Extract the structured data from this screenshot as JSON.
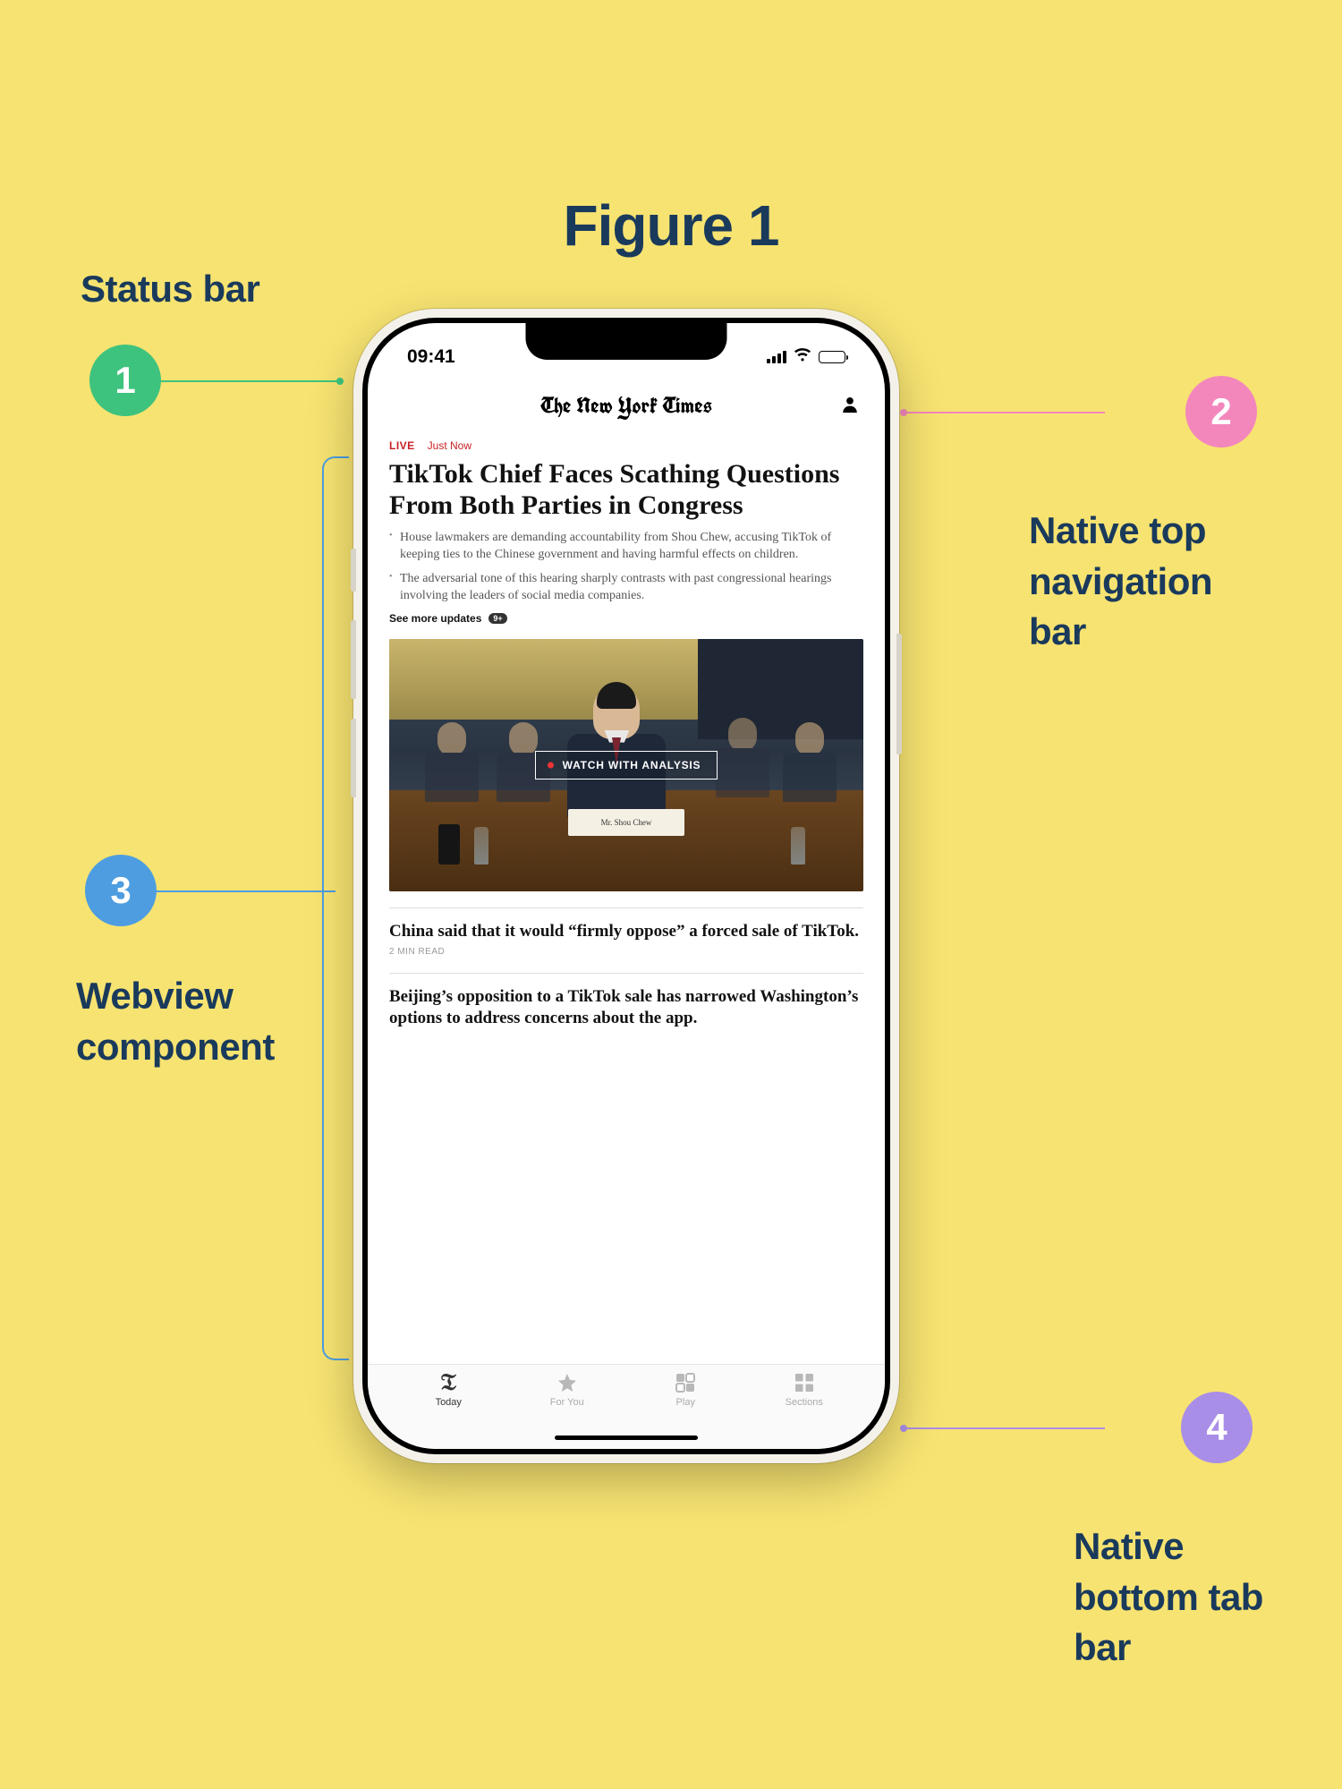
{
  "figure": {
    "title": "Figure 1"
  },
  "annotations": {
    "n1": {
      "num": "1",
      "label": "Status bar",
      "color": "#3ec37e"
    },
    "n2": {
      "num": "2",
      "label": "Native top navigation bar",
      "color": "#f387bc"
    },
    "n3": {
      "num": "3",
      "label": "Webview component",
      "color": "#4d9de0"
    },
    "n4": {
      "num": "4",
      "label": "Native bottom tab bar",
      "color": "#a98ee8"
    }
  },
  "phone": {
    "status_bar": {
      "time": "09:41"
    },
    "top_nav": {
      "title": "The New York Times"
    },
    "content": {
      "live": {
        "badge": "LIVE",
        "time": "Just Now"
      },
      "headline": "TikTok Chief Faces Scathing Questions From Both Parties in Congress",
      "bullets": [
        "House lawmakers are demanding accountability from Shou Chew, accusing TikTok of keeping ties to the Chinese government and having harmful effects on children.",
        "The adversarial tone of this hearing sharply contrasts with past congressional hearings involving the leaders of social media companies."
      ],
      "see_more": {
        "label": "See more updates",
        "count": "9+"
      },
      "video": {
        "button_label": "WATCH WITH ANALYSIS",
        "nameplate": "Mr. Shou Chew"
      },
      "story2": {
        "headline": "China said that it would “firmly oppose” a forced sale of TikTok.",
        "read_time": "2 MIN READ"
      },
      "story3": {
        "headline": "Beijing’s opposition to a TikTok sale has narrowed Washington’s options to address concerns about the app."
      }
    },
    "tabs": [
      {
        "label": "Today",
        "active": true
      },
      {
        "label": "For You",
        "active": false
      },
      {
        "label": "Play",
        "active": false
      },
      {
        "label": "Sections",
        "active": false
      }
    ]
  }
}
